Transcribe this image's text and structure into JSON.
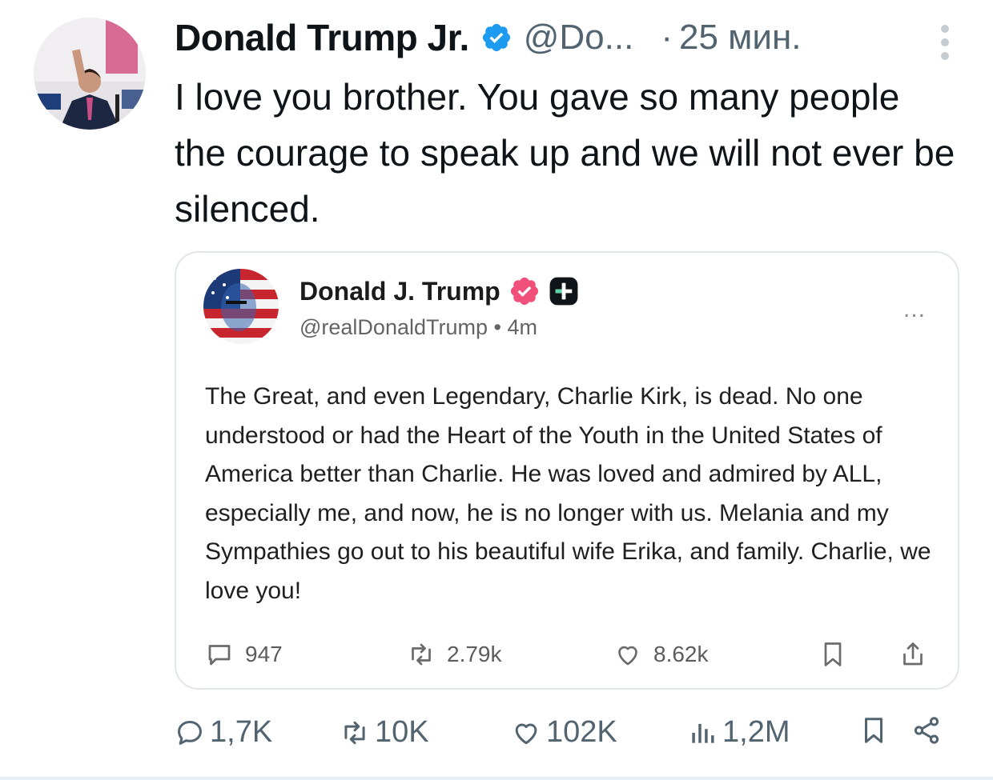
{
  "tweet": {
    "author_name": "Donald Trump Jr.",
    "handle": "@Do...",
    "separator": "·",
    "time": "25 мин.",
    "text": "I love you brother. You gave so many people the courage to speak up and we will not ever be silenced.",
    "verified_color": "#1d9bf0",
    "more_icon": "vertical-dots-icon"
  },
  "quote": {
    "author_name": "Donald J. Trump",
    "handle_line": "@realDonaldTrump • 4m",
    "badge_color": "#f0507a",
    "more": "...",
    "text": "The Great, and even Legendary, Charlie Kirk, is dead. No one understood or had the Heart of the Youth in the United States of America better than Charlie. He was loved and admired by ALL, especially me, and now, he is no longer with us. Melania and my Sympathies go out to his beautiful wife Erika, and family. Charlie, we love you!",
    "replies": "947",
    "reposts": "2.79k",
    "likes": "8.62k"
  },
  "actions": {
    "replies": "1,7K",
    "reposts": "10K",
    "likes": "102K",
    "views": "1,2M"
  },
  "colors": {
    "text_primary": "#0f1419",
    "text_secondary": "#536471",
    "border": "#e1e6ea"
  }
}
